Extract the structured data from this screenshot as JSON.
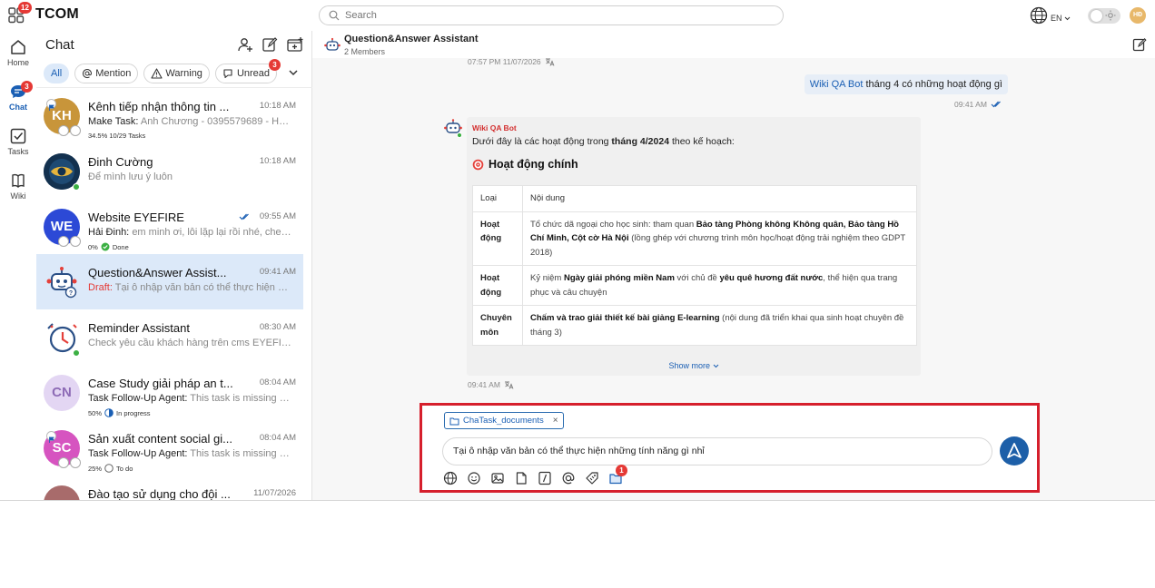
{
  "app": {
    "brand": "TCOM",
    "apps_badge": "12",
    "search_placeholder": "Search",
    "language": "EN",
    "user_initials": "HĐ"
  },
  "rail": {
    "items": [
      {
        "label": "Home"
      },
      {
        "label": "Chat",
        "badge": "3"
      },
      {
        "label": "Tasks"
      },
      {
        "label": "Wiki"
      }
    ]
  },
  "chat_panel": {
    "title": "Chat",
    "filters": [
      {
        "label": "All"
      },
      {
        "label": "Mention"
      },
      {
        "label": "Warning"
      },
      {
        "label": "Unread",
        "badge": "3"
      }
    ],
    "conversations": [
      {
        "initials": "KH",
        "name": "Kênh tiếp nhận thông tin ...",
        "time": "10:18 AM",
        "who": "Make Task:",
        "preview": "Anh Chương - 0395579689 - Họ...",
        "meta": "34.5% 10/29 Tasks",
        "color": "#c8953a"
      },
      {
        "initials": "",
        "name": "Đinh Cường",
        "time": "10:18 AM",
        "who": "",
        "preview": "Để mình lưu ý luôn",
        "meta": "",
        "color": "#1f3a5f"
      },
      {
        "initials": "WE",
        "name": "Website EYEFIRE",
        "time": "09:55 AM",
        "who": "Hải Đinh:",
        "preview": "em minh ơi, lỗi lặp lại rồi nhé, check g...",
        "meta_progress": "0%",
        "meta_status": "Done",
        "color": "#2c49d6"
      },
      {
        "initials": "",
        "name": "Question&Answer Assist...",
        "time": "09:41 AM",
        "who": "Draft:",
        "preview": "Tại ô nhập văn bản có thể thực hiện nhữ...",
        "meta": "",
        "color": "#ffffff"
      },
      {
        "initials": "",
        "name": "Reminder Assistant",
        "time": "08:30 AM",
        "who": "",
        "preview": "Check yêu cầu khách hàng trên cms EYEFIRE ...",
        "meta": "",
        "color": "#ffffff"
      },
      {
        "initials": "CN",
        "name": "Case Study giải pháp an t...",
        "time": "08:04 AM",
        "who": "Task Follow-Up Agent:",
        "preview": "This task is missing da...",
        "meta_progress": "50%",
        "meta_status": "In progress",
        "color": "#e3d6f3"
      },
      {
        "initials": "SC",
        "name": "Sản xuất content social gi...",
        "time": "08:04 AM",
        "who": "Task Follow-Up Agent:",
        "preview": "This task is missing da...",
        "meta_progress": "25%",
        "meta_status": "To do",
        "color": "#d654c0"
      },
      {
        "initials": "",
        "name": "Đào tạo sử dụng cho đội ...",
        "time": "11/07/2026",
        "who": "",
        "preview": "",
        "meta": "",
        "color": "#a86b6b"
      }
    ]
  },
  "conversation": {
    "title": "Question&Answer Assistant",
    "subtitle": "2 Members",
    "prev_time": "07:57 PM 11/07/2026",
    "out_mention": "Wiki QA Bot",
    "out_text": "tháng 4 có những hoạt động gì",
    "out_time": "09:41 AM",
    "bot_name": "Wiki QA Bot",
    "bot_intro_pre": "Dưới đây là các hoạt động trong ",
    "bot_intro_bold": "tháng 4/2024",
    "bot_intro_post": " theo kế hoạch:",
    "bot_heading": "Hoạt động chính",
    "table_headers": [
      "Loại",
      "Nội dung"
    ],
    "rows": [
      {
        "k": "Hoạt động",
        "p1": "Tổ chức dã ngoại cho học sinh: tham quan ",
        "b1": "Bảo tàng Phòng không Không quân, Bảo tàng Hồ Chí Minh, Cột cờ Hà Nội",
        "p2": " (lồng ghép với chương trình môn học/hoạt động trải nghiệm theo GDPT 2018)",
        "b2": "",
        "p3": ""
      },
      {
        "k": "Hoạt động",
        "p1": "Kỷ niệm ",
        "b1": "Ngày giải phóng miền Nam",
        "p2": " với chủ đề ",
        "b2": "yêu quê hương đất nước",
        "p3": ", thể hiện qua trang phục và câu chuyện"
      },
      {
        "k": "Chuyên môn",
        "p1": "",
        "b1": "Chấm và trao giải thiết kế bài giảng E-learning",
        "p2": " (nội dung đã triển khai qua sinh hoạt chuyên đề tháng 3)",
        "b2": "",
        "p3": ""
      }
    ],
    "show_more": "Show more",
    "bot_time": "09:41 AM"
  },
  "composer": {
    "attachment": "ChaTask_documents",
    "text": "Tại ô nhập văn bản có thể thực hiện những tính năng gì nhỉ",
    "tool_badge": "1"
  }
}
